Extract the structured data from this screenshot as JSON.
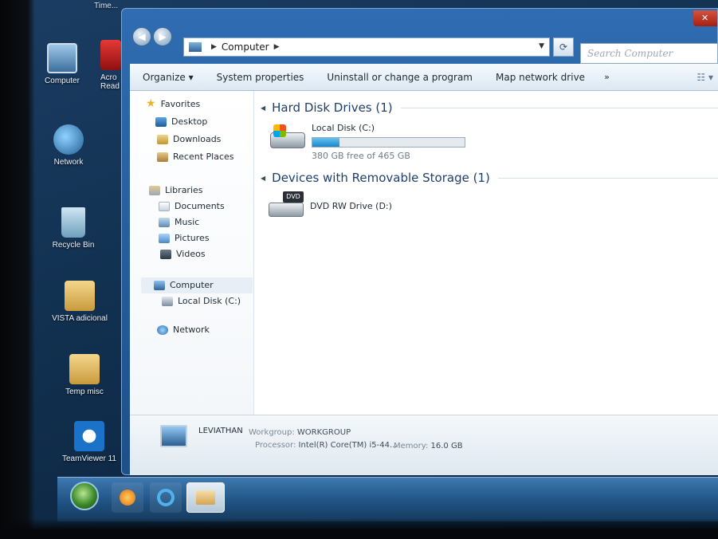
{
  "desktop": {
    "top_text": "Time...",
    "icons": [
      {
        "label": "Computer"
      },
      {
        "label": "Acro Read"
      },
      {
        "label": "Network"
      },
      {
        "label": "Recycle Bin"
      },
      {
        "label": "VISTA adicional"
      },
      {
        "label": "Temp misc"
      },
      {
        "label": "TeamViewer 11"
      }
    ]
  },
  "window": {
    "address": {
      "root": "Computer"
    },
    "search_placeholder": "Search Computer",
    "toolbar": {
      "organize": "Organize",
      "system_properties": "System properties",
      "uninstall": "Uninstall or change a program",
      "map_drive": "Map network drive",
      "more": "»"
    },
    "nav": {
      "favorites": "Favorites",
      "desktop": "Desktop",
      "downloads": "Downloads",
      "recent_places": "Recent Places",
      "libraries": "Libraries",
      "documents": "Documents",
      "music": "Music",
      "pictures": "Pictures",
      "videos": "Videos",
      "computer": "Computer",
      "local_disk": "Local Disk (C:)",
      "network": "Network"
    },
    "content": {
      "hdd_group": "Hard Disk Drives (1)",
      "removable_group": "Devices with Removable Storage (1)",
      "local_disk": {
        "name": "Local Disk (C:)",
        "free_text": "380 GB free of 465 GB",
        "used_fraction": 0.18
      },
      "dvd": {
        "name": "DVD RW Drive (D:)",
        "badge": "DVD"
      }
    },
    "details": {
      "computer_name": "LEVIATHAN",
      "workgroup_label": "Workgroup:",
      "workgroup": "WORKGROUP",
      "memory_label": "Memory:",
      "memory": "16.0 GB",
      "processor_label": "Processor:",
      "processor": "Intel(R) Core(TM) i5-44..."
    }
  }
}
